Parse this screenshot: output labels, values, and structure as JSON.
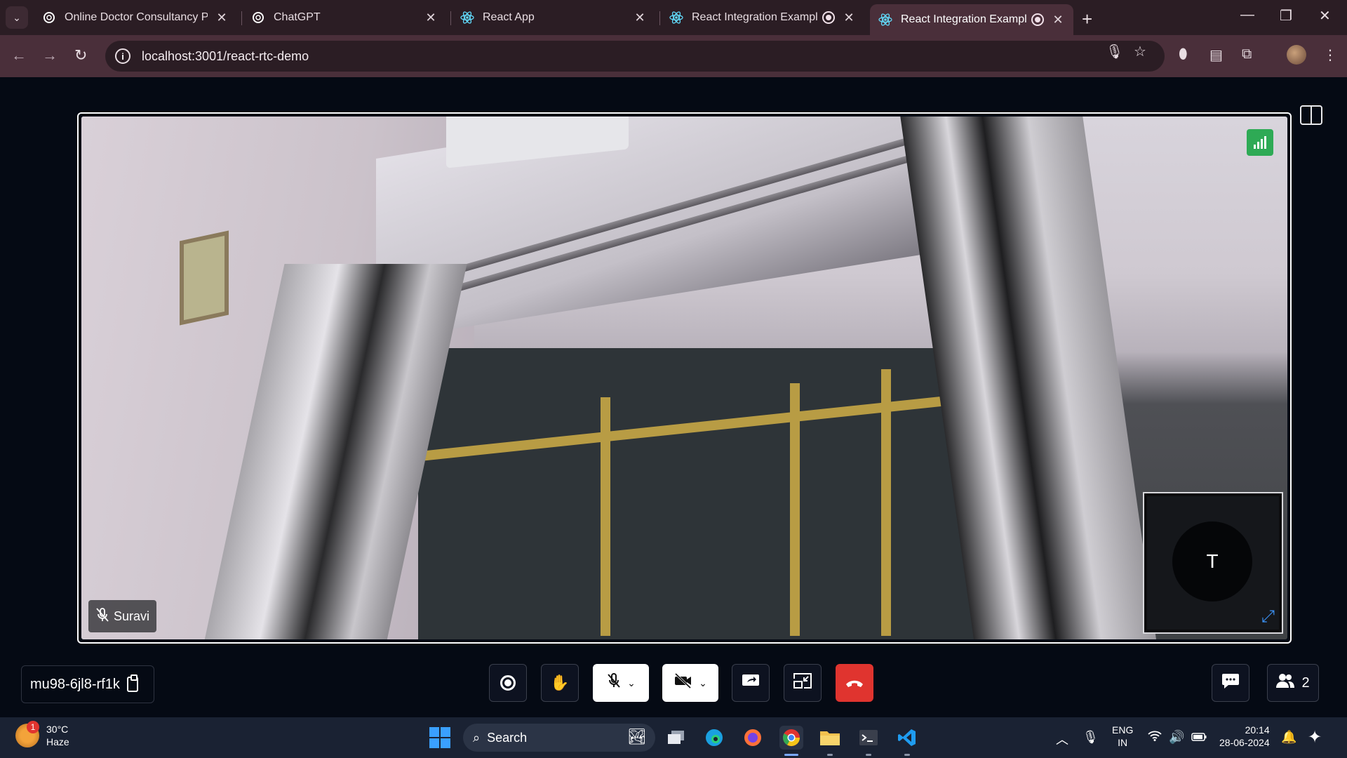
{
  "browser": {
    "tabs": [
      {
        "title": "Online Doctor Consultancy Plat",
        "favicon": "chatgpt-icon",
        "recording": false,
        "active": false
      },
      {
        "title": "ChatGPT",
        "favicon": "chatgpt-icon",
        "recording": false,
        "active": false
      },
      {
        "title": "React App",
        "favicon": "react-icon",
        "recording": false,
        "active": false
      },
      {
        "title": "React Integration Example C",
        "favicon": "react-icon",
        "recording": true,
        "active": false
      },
      {
        "title": "React Integration Example C",
        "favicon": "react-icon",
        "recording": true,
        "active": true
      }
    ],
    "url": "localhost:3001/react-rtc-demo"
  },
  "meeting": {
    "participant_name": "Suravi",
    "self_avatar_letter": "T",
    "meeting_id": "mu98-6jl8-rf1k",
    "participants_count": "2",
    "colors": {
      "end_call": "#e0342f",
      "signal": "#2eaa55",
      "expand": "#3a8ff0"
    }
  },
  "taskbar": {
    "weather_temp": "30°C",
    "weather_desc": "Haze",
    "weather_badge": "1",
    "search_placeholder": "Search",
    "lang_1": "ENG",
    "lang_2": "IN",
    "time": "20:14",
    "date": "28-06-2024"
  }
}
